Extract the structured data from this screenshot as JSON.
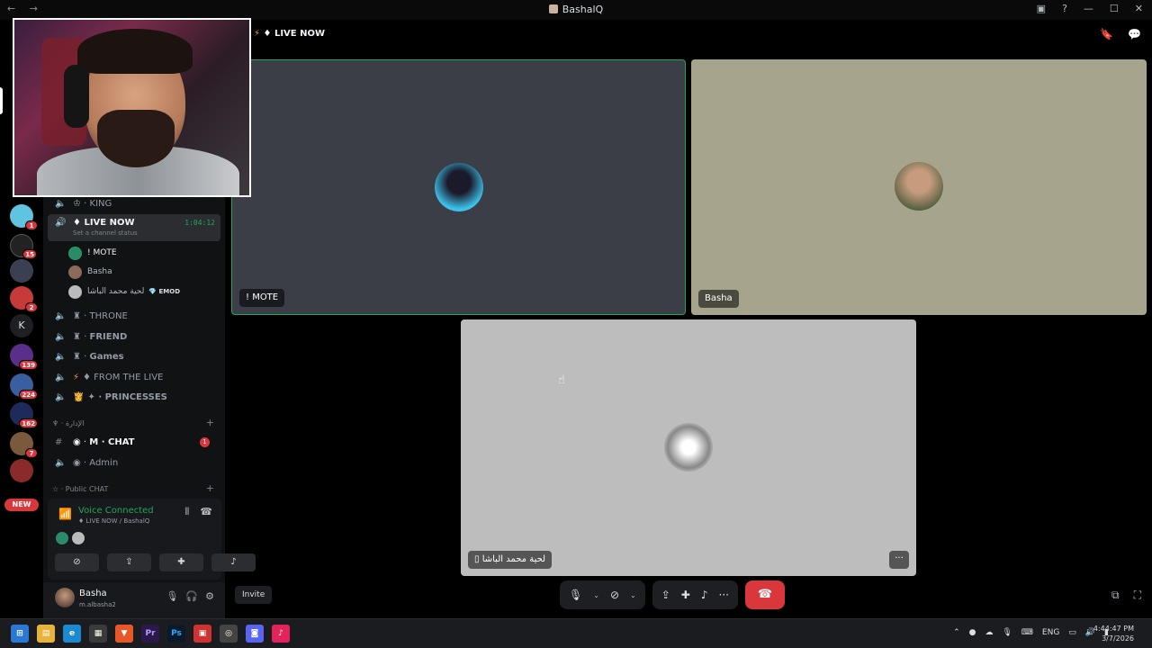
{
  "window": {
    "title": "BashalQ",
    "nav": "← →"
  },
  "channel_header": {
    "title": "♦ LIVE NOW"
  },
  "guilds": {
    "badges": [
      "1",
      "15",
      "2",
      "139",
      "224",
      "162",
      "7"
    ],
    "letter": "K",
    "new_label": "NEW"
  },
  "channels": [
    {
      "name": "KING",
      "prefix": "♔ ·"
    },
    {
      "name": "♦ LIVE NOW",
      "timer": "1:04:12",
      "status": "Set a channel status"
    },
    {
      "name": "THRONE",
      "prefix": "♜ ·"
    },
    {
      "name": "FRIEND",
      "prefix": "♜ ·"
    },
    {
      "name": "Games",
      "prefix": "♜ ·"
    },
    {
      "name": "♦ FROM THE LIVE"
    },
    {
      "name": "✦ · PRINCESSES"
    },
    {
      "name": "M · CHAT",
      "prefix": "◉ ·",
      "unread": "1"
    },
    {
      "name": "Admin",
      "prefix": "◉ ·"
    }
  ],
  "categories": [
    "♆ · الإدارة",
    "☆ · Public CHAT"
  ],
  "voice_users": [
    {
      "name": "! MOTE"
    },
    {
      "name": "Basha"
    },
    {
      "name": "لحية محمد الباشا",
      "tag": "EMOD"
    }
  ],
  "voice_panel": {
    "status": "Voice Connected",
    "location": "♦ LIVE NOW / BashalQ"
  },
  "user": {
    "name": "Basha",
    "handle": "m.albasha2"
  },
  "tiles": [
    {
      "label": "! MOTE"
    },
    {
      "label": "Basha"
    },
    {
      "label": "لحية محمد الباشا"
    }
  ],
  "controls": {
    "invite_label": "Invite"
  },
  "taskbar": {
    "lang": "ENG",
    "time": "4:44:47 PM",
    "date": "3/7/2026"
  },
  "colors": {
    "online_green": "#23a55a",
    "danger_red": "#da373c",
    "speaking_border": "#23a55a"
  }
}
